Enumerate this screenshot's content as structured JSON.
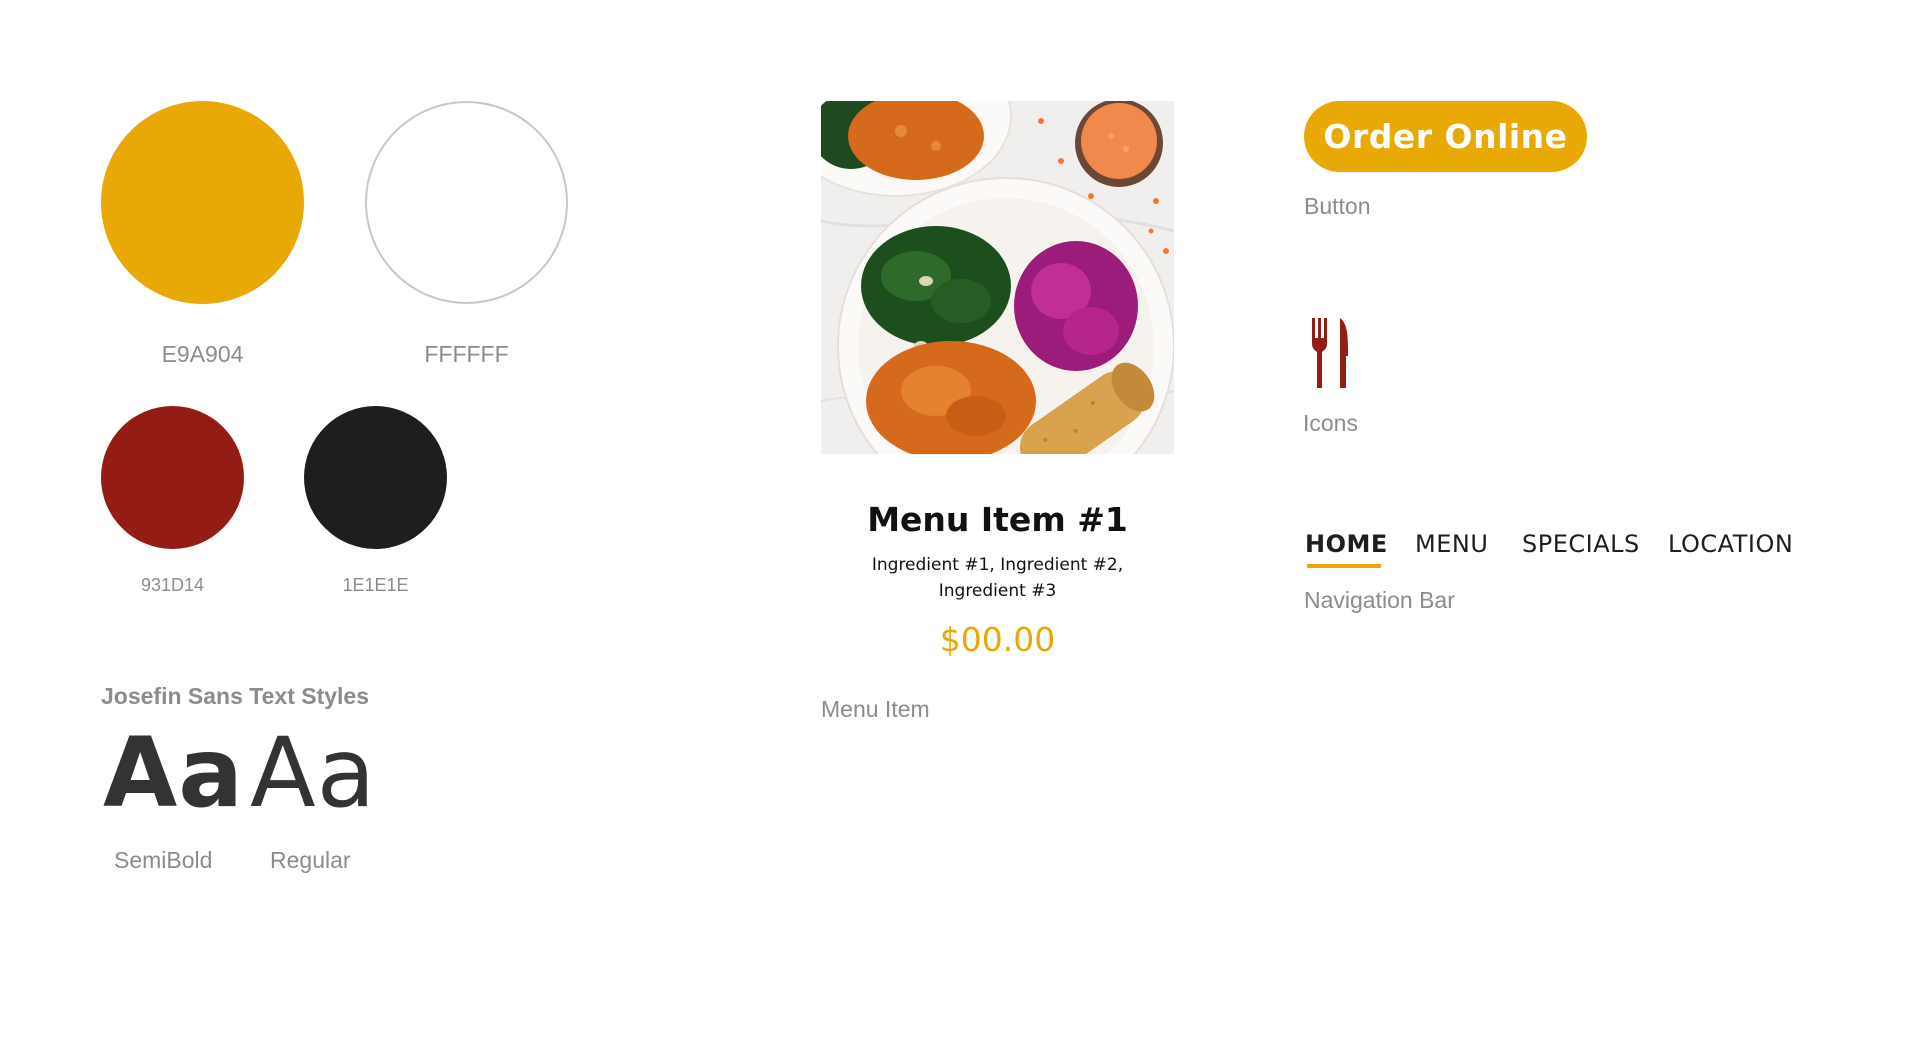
{
  "colors": {
    "gold": "#E9A904",
    "white": "#FFFFFF",
    "red": "#931D14",
    "black": "#1E1E1E"
  },
  "palette": {
    "gold_code": "E9A904",
    "white_code": "FFFFFF",
    "red_code": "931D14",
    "black_code": "1E1E1E"
  },
  "typography": {
    "heading": "Josefin Sans Text Styles",
    "sample_semibold": "Aa",
    "sample_regular": "Aa",
    "label_semibold": "SemiBold",
    "label_regular": "Regular"
  },
  "menu_item": {
    "title": "Menu Item #1",
    "ingredients_line1": "Ingredient #1, Ingredient #2,",
    "ingredients_line2": "Ingredient #3",
    "price": "$00.00",
    "caption": "Menu Item",
    "image": "food-plate-image"
  },
  "button": {
    "label": "Order Online",
    "caption": "Button"
  },
  "icons": {
    "icon": "fork-knife-icon",
    "caption": "Icons"
  },
  "nav": {
    "items": [
      {
        "label": "HOME",
        "active": true
      },
      {
        "label": "MENU",
        "active": false
      },
      {
        "label": "SPECIALS",
        "active": false
      },
      {
        "label": "LOCATION",
        "active": false
      }
    ],
    "caption": "Navigation Bar"
  }
}
